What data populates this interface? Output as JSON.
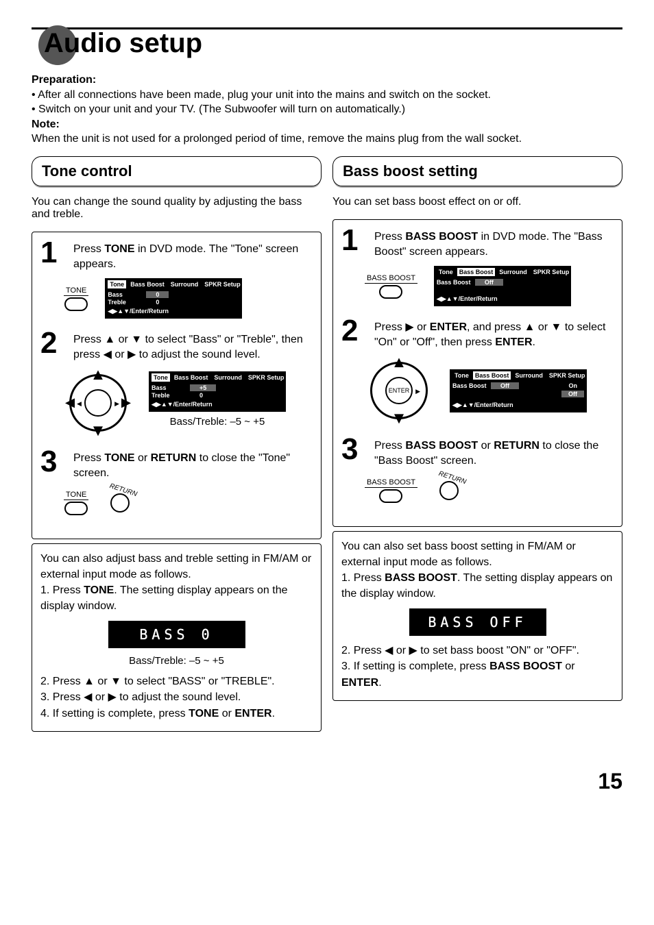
{
  "page_number": "15",
  "title": "Audio setup",
  "intro": {
    "prep_hdr": "Preparation:",
    "prep_1": "• After all connections have been made, plug your unit into the mains and switch on the socket.",
    "prep_2": "• Switch on your unit and your TV. (The Subwoofer will turn on automatically.)",
    "note_hdr": "Note:",
    "note_1": "When the unit is not used for a prolonged period of time, remove the mains plug from the wall socket."
  },
  "left": {
    "heading": "Tone control",
    "lead": "You can change the sound quality by adjusting the bass and treble.",
    "step1_pre": "Press ",
    "step1_btn": "TONE",
    "step1_post": " in DVD mode. The \"Tone\" screen appears.",
    "btn_tone_label": "TONE",
    "osd1": {
      "tabs": {
        "a": "Tone",
        "b": "Bass Boost",
        "c": "Surround",
        "d": "SPKR Setup"
      },
      "r1k": "Bass",
      "r1v": "0",
      "r2k": "Treble",
      "r2v": "0",
      "hint": "◀▶▲▼/Enter/Return"
    },
    "step2": "Press ▲ or ▼ to select \"Bass\" or \"Treble\", then press ◀ or ▶ to adjust the sound level.",
    "osd2": {
      "tabs": {
        "a": "Tone",
        "b": "Bass Boost",
        "c": "Surround",
        "d": "SPKR Setup"
      },
      "r1k": "Bass",
      "r1v": "+5",
      "r2k": "Treble",
      "r2v": "0",
      "hint": "◀▶▲▼/Enter/Return"
    },
    "range": "Bass/Treble: –5 ~ +5",
    "step3_a": "Press ",
    "step3_b": "TONE",
    "step3_c": " or ",
    "step3_d": "RETURN",
    "step3_e": " to close the \"Tone\" screen.",
    "return_label": "RETURN",
    "follow": {
      "p1": "You can also adjust bass and treble setting in FM/AM or external input mode as follows.",
      "p2a": "1. Press ",
      "p2b": "TONE",
      "p2c": ". The setting display appears on the display window.",
      "disp": "BASS   0",
      "range": "Bass/Treble: –5 ~ +5",
      "p3": "2. Press ▲ or ▼ to select \"BASS\" or \"TREBLE\".",
      "p4": "3. Press ◀ or ▶ to adjust the sound level.",
      "p5a": "4. If setting is complete, press ",
      "p5b": "TONE",
      "p5c": " or ",
      "p5d": "ENTER",
      "p5e": "."
    }
  },
  "right": {
    "heading": "Bass boost setting",
    "lead": "You can set bass boost effect on or off.",
    "step1_pre": "Press ",
    "step1_btn": "BASS BOOST",
    "step1_post": " in DVD mode. The \"Bass Boost\" screen appears.",
    "btn_bb_label": "BASS BOOST",
    "osd1": {
      "tabs": {
        "a": "Tone",
        "b": "Bass Boost",
        "c": "Surround",
        "d": "SPKR Setup"
      },
      "r1k": "Bass Boost",
      "r1v": "Off",
      "hint": "◀▶▲▼/Enter/Return"
    },
    "step2_a": "Press ▶ or ",
    "step2_b": "ENTER",
    "step2_c": ", and press ▲ or ▼ to select \"On\" or \"Off\", then press ",
    "step2_d": "ENTER",
    "step2_e": ".",
    "dpad_center": "ENTER",
    "osd2": {
      "tabs": {
        "a": "Tone",
        "b": "Bass Boost",
        "c": "Surround",
        "d": "SPKR Setup"
      },
      "r1k": "Bass Boost",
      "r1v": "Off",
      "opt_on": "On",
      "opt_off": "Off",
      "hint": "◀▶▲▼/Enter/Return"
    },
    "step3_a": "Press ",
    "step3_b": "BASS BOOST",
    "step3_c": " or ",
    "step3_d": "RETURN",
    "step3_e": " to close the \"Bass Boost\" screen.",
    "return_label": "RETURN",
    "follow": {
      "p1": "You can also set bass boost setting in FM/AM or external input mode as follows.",
      "p2a": "1. Press ",
      "p2b": "BASS BOOST",
      "p2c": ". The setting display appears on the display window.",
      "disp": "BASS OFF",
      "p3": "2. Press ◀ or ▶ to set bass boost \"ON\" or \"OFF\".",
      "p4a": "3. If setting is complete, press ",
      "p4b": "BASS BOOST",
      "p4c": " or ",
      "p4d": "ENTER",
      "p4e": "."
    }
  }
}
